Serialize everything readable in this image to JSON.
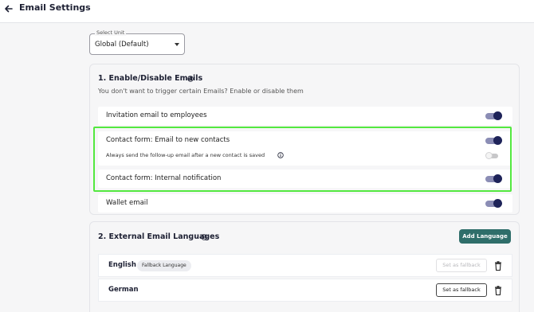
{
  "header": {
    "title": "Email Settings"
  },
  "unit_select": {
    "label": "Select Unit",
    "value": "Global (Default)"
  },
  "section1": {
    "title": "1. Enable/Disable Emails",
    "description": "You don't want to trigger certain Emails? Enable or disable them",
    "rows": [
      {
        "label": "Invitation email to employees",
        "enabled": true
      },
      {
        "label": "Contact form: Email to new contacts",
        "enabled": true,
        "sub": {
          "label": "Always send the follow-up email after a new contact is saved",
          "enabled": false
        }
      },
      {
        "label": "Contact form: Internal notification",
        "enabled": true
      },
      {
        "label": "Wallet email",
        "enabled": true
      }
    ]
  },
  "section2": {
    "title": "2. External Email Languages",
    "add_button": "Add Language",
    "languages": [
      {
        "name": "English",
        "badge": "Fallback Language",
        "action": "Set as fallback",
        "action_enabled": false
      },
      {
        "name": "German",
        "badge": "",
        "action": "Set as fallback",
        "action_enabled": true
      }
    ]
  },
  "colors": {
    "highlight": "#53e83f",
    "toggle_on": "#1e2359",
    "primary_button": "#2f6e6a"
  }
}
